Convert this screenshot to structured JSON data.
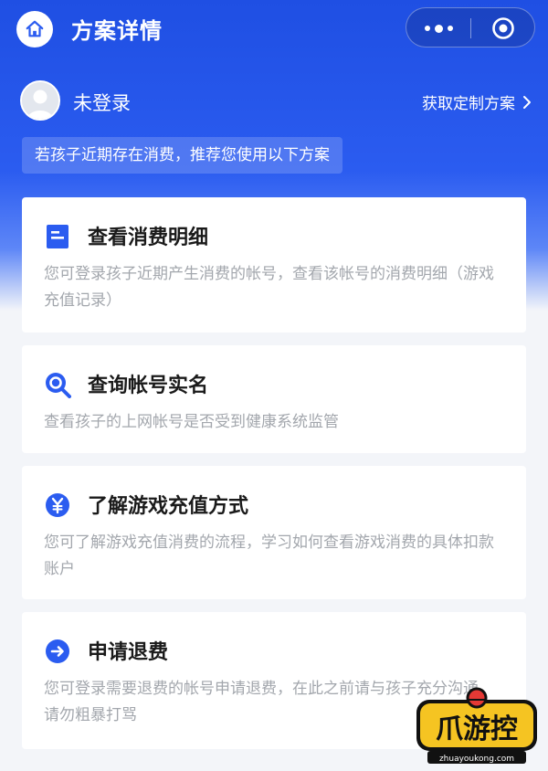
{
  "nav": {
    "title": "方案详情"
  },
  "user": {
    "name": "未登录",
    "plan_link": "获取定制方案"
  },
  "notice": "若孩子近期存在消费，推荐您使用以下方案",
  "cards": [
    {
      "icon": "document-icon",
      "title": "查看消费明细",
      "desc": "您可登录孩子近期产生消费的帐号，查看该帐号的消费明细（游戏充值记录）"
    },
    {
      "icon": "magnifier-icon",
      "title": "查询帐号实名",
      "desc": "查看孩子的上网帐号是否受到健康系统监管"
    },
    {
      "icon": "yen-icon",
      "title": "了解游戏充值方式",
      "desc": "您可了解游戏充值消费的流程，学习如何查看游戏消费的具体扣款账户"
    },
    {
      "icon": "arrow-right-icon",
      "title": "申请退费",
      "desc": "您可登录需要退费的帐号申请退费，在此之前请与孩子充分沟通，请勿粗暴打骂"
    }
  ],
  "colors": {
    "primary": "#2b5cf0",
    "text": "#1a1a1a",
    "muted": "#a3a7ad"
  },
  "watermark": {
    "text": "爪游控",
    "domain": "zhuayoukong.com"
  }
}
